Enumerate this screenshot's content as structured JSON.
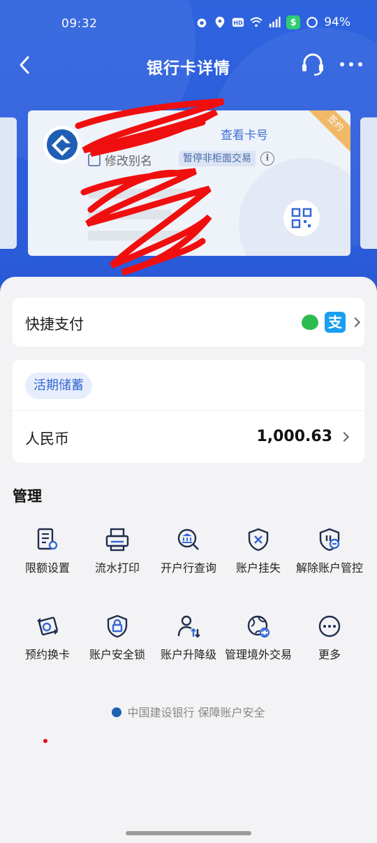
{
  "status_bar": {
    "time": "09:32",
    "battery": "94%",
    "badge": "$"
  },
  "nav": {
    "title": "银行卡详情"
  },
  "card": {
    "view_card_number": "查看卡号",
    "edit_alias": "修改别名",
    "suspend_tag": "暂停非柜面交易",
    "sign_badge": "签约"
  },
  "quick_pay": {
    "label": "快捷支付",
    "alipay_glyph": "支"
  },
  "savings": {
    "tag": "活期储蓄",
    "currency": "人民币",
    "balance": "1,000.63"
  },
  "management": {
    "title": "管理",
    "items": [
      {
        "label": "限额设置",
        "icon": "limit-settings-icon"
      },
      {
        "label": "流水打印",
        "icon": "printer-icon"
      },
      {
        "label": "开户行查询",
        "icon": "bank-search-icon"
      },
      {
        "label": "账户挂失",
        "icon": "shield-x-icon"
      },
      {
        "label": "解除账户管控",
        "icon": "shield-minus-icon"
      },
      {
        "label": "预约换卡",
        "icon": "card-swap-icon"
      },
      {
        "label": "账户安全锁",
        "icon": "shield-lock-icon"
      },
      {
        "label": "账户升降级",
        "icon": "user-updown-icon"
      },
      {
        "label": "管理境外交易",
        "icon": "globe-cycle-icon"
      },
      {
        "label": "更多",
        "icon": "more-circle-icon"
      }
    ]
  },
  "footer": {
    "text": "中国建设银行 保障账户安全"
  },
  "colors": {
    "brand_blue": "#2b5cdc",
    "accent_blue": "#3568d4",
    "sign_orange": "#f0b867"
  }
}
